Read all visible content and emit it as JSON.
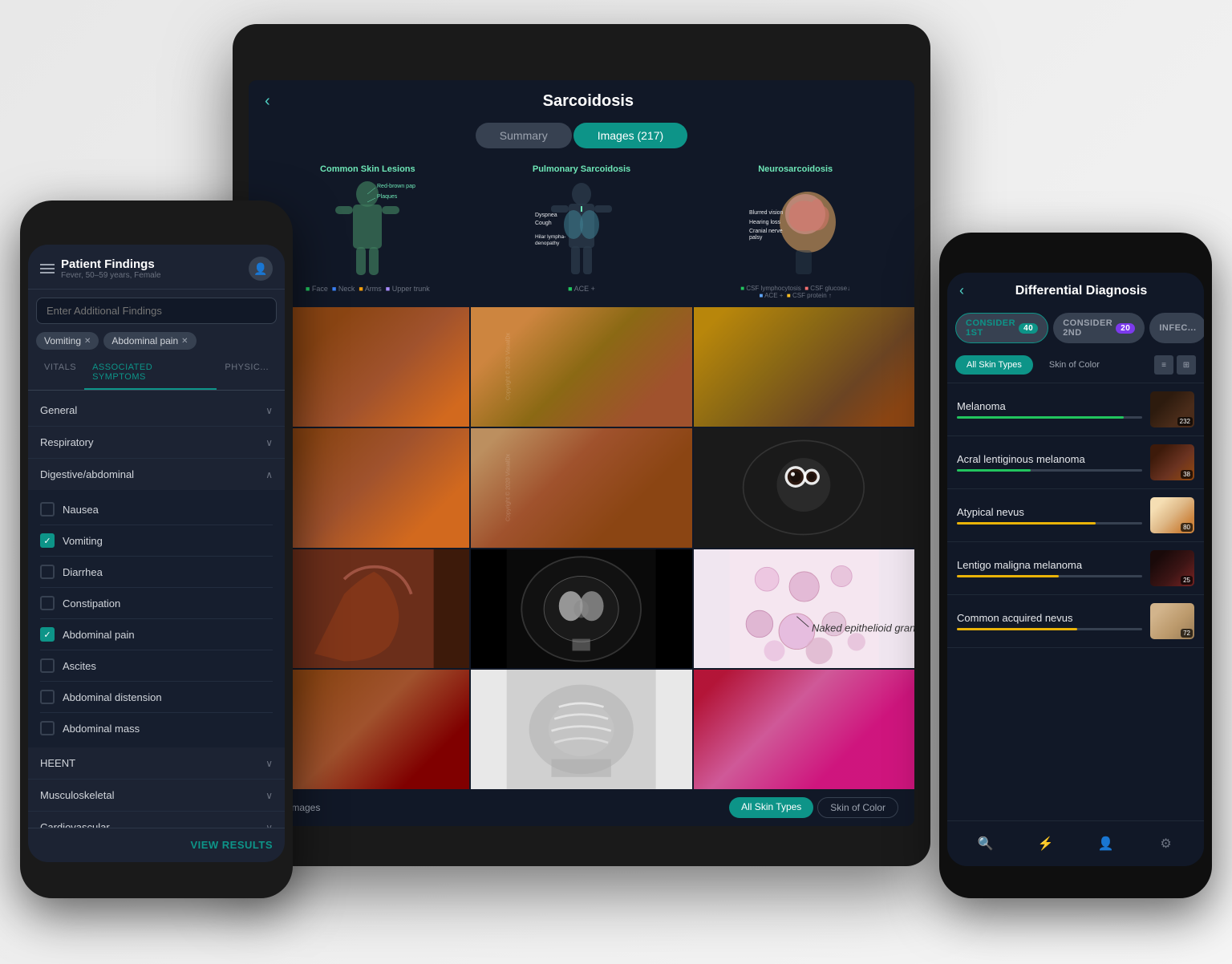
{
  "tablet": {
    "title": "Sarcoidosis",
    "back_label": "‹",
    "tabs": [
      {
        "label": "Summary",
        "active": false
      },
      {
        "label": "Images (217)",
        "active": true
      }
    ],
    "anatomy": [
      {
        "label": "Common Skin Lesions",
        "findings": [
          "Red-brown papules",
          "Plaques"
        ],
        "footer": "■ Face  ■ Neck  ■ Arms  ■ Upper trunk"
      },
      {
        "label": "Pulmonary Sarcoidosis",
        "findings": [
          "Dyspnea",
          "Cough",
          "Hilar lymphadenopathy"
        ],
        "footer": "■ ACE +"
      },
      {
        "label": "Neurosarcoidosis",
        "findings": [
          "Blurred vision",
          "Hearing loss",
          "Cranial nerve palsy"
        ],
        "footer": "■ CSF lymphocytosis  ■ CSF glucose↓\n■ ACE +  ■ CSF protein ↑"
      }
    ],
    "filter_label": "Filter Images",
    "filter_btns": [
      {
        "label": "All Skin Types",
        "active": true
      },
      {
        "label": "Skin of Color",
        "active": false
      }
    ],
    "copyright": "Copyright © 2020 VisualDx"
  },
  "phone_left": {
    "title": "Patient Findings",
    "subtitle": "Fever, 50–59 years, Female",
    "search_placeholder": "Enter Additional Findings",
    "tags": [
      {
        "label": "Vomiting"
      },
      {
        "label": "Abdominal pain"
      }
    ],
    "tabs": [
      {
        "label": "VITALS",
        "active": false
      },
      {
        "label": "ASSOCIATED SYMPTOMS",
        "active": true
      },
      {
        "label": "PHYSIC...",
        "active": false
      }
    ],
    "categories": [
      {
        "label": "General",
        "expanded": false
      },
      {
        "label": "Respiratory",
        "expanded": false
      },
      {
        "label": "Digestive/abdominal",
        "expanded": true,
        "symptoms": [
          {
            "label": "Nausea",
            "checked": false
          },
          {
            "label": "Vomiting",
            "checked": true
          },
          {
            "label": "Diarrhea",
            "checked": false
          },
          {
            "label": "Constipation",
            "checked": false
          },
          {
            "label": "Abdominal pain",
            "checked": true
          },
          {
            "label": "Ascites",
            "checked": false
          },
          {
            "label": "Abdominal distension",
            "checked": false
          },
          {
            "label": "Abdominal mass",
            "checked": false
          }
        ]
      },
      {
        "label": "HEENT",
        "expanded": false
      },
      {
        "label": "Musculoskeletal",
        "expanded": false
      },
      {
        "label": "Cardiovascular",
        "expanded": false
      }
    ],
    "view_results_label": "VIEW RESULTS"
  },
  "phone_right": {
    "title": "Differential Diagnosis",
    "back_label": "‹",
    "consider_tabs": [
      {
        "label": "CONSIDER 1ST",
        "badge": "40",
        "active": true
      },
      {
        "label": "CONSIDER 2ND",
        "badge": "20",
        "active": false
      },
      {
        "label": "INFEC...",
        "badge": null,
        "active": false
      }
    ],
    "skin_filters": [
      {
        "label": "All Skin Types",
        "active": true
      },
      {
        "label": "Skin of Color",
        "active": false
      }
    ],
    "diagnoses": [
      {
        "name": "Melanoma",
        "bar_width": "90%",
        "bar_color": "bar-green",
        "count": "232",
        "thumb_class": "thumb-melanoma"
      },
      {
        "name": "Acral lentiginous melanoma",
        "bar_width": "40%",
        "bar_color": "bar-green",
        "count": "38",
        "thumb_class": "thumb-acral"
      },
      {
        "name": "Atypical nevus",
        "bar_width": "75%",
        "bar_color": "bar-yellow",
        "count": "80",
        "thumb_class": "thumb-atypical"
      },
      {
        "name": "Lentigo maligna melanoma",
        "bar_width": "55%",
        "bar_color": "bar-yellow",
        "count": "25",
        "thumb_class": "thumb-lentigo"
      },
      {
        "name": "Common acquired nevus",
        "bar_width": "65%",
        "bar_color": "bar-yellow",
        "count": "72",
        "thumb_class": "thumb-common"
      }
    ],
    "nav_icons": [
      "🔍",
      "⚡",
      "👤",
      "⚙"
    ]
  },
  "colors": {
    "teal": "#0d9488",
    "dark_bg": "#111827",
    "card_bg": "#1c2333",
    "border": "#374151"
  }
}
